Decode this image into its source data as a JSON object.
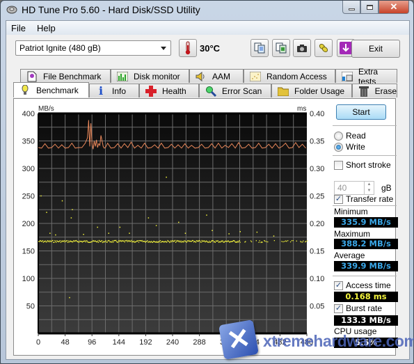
{
  "window": {
    "title": "HD Tune Pro 5.60 - Hard Disk/SSD Utility",
    "controls": {
      "minimize": "minimize",
      "maximize": "maximize",
      "close": "close"
    }
  },
  "menu": {
    "file": "File",
    "help": "Help"
  },
  "toolbar": {
    "drive": "Patriot Ignite (480 gB)",
    "temperature": "30°C",
    "icons": [
      "copy-text-icon",
      "copy-screenshot-icon",
      "camera-icon",
      "coins-icon",
      "download-icon"
    ],
    "exit_label": "Exit"
  },
  "tabs": {
    "row_back": [
      {
        "label": "File Benchmark",
        "icon": "file-benchmark-icon"
      },
      {
        "label": "Disk monitor",
        "icon": "disk-monitor-icon"
      },
      {
        "label": "AAM",
        "icon": "speaker-icon"
      },
      {
        "label": "Random Access",
        "icon": "random-access-icon"
      },
      {
        "label": "Extra tests",
        "icon": "extra-tests-icon"
      }
    ],
    "row_front": [
      {
        "label": "Benchmark",
        "icon": "lightbulb-icon",
        "active": true
      },
      {
        "label": "Info",
        "icon": "info-icon"
      },
      {
        "label": "Health",
        "icon": "health-cross-icon"
      },
      {
        "label": "Error Scan",
        "icon": "magnifier-icon"
      },
      {
        "label": "Folder Usage",
        "icon": "folder-icon"
      },
      {
        "label": "Erase",
        "icon": "trash-icon"
      }
    ]
  },
  "side": {
    "start_label": "Start",
    "read_label": "Read",
    "write_label": "Write",
    "mode": "Write",
    "short_stroke_label": "Short stroke",
    "short_stroke_checked": false,
    "short_stroke_value": "40",
    "short_stroke_unit": "gB",
    "transfer_rate_label": "Transfer rate",
    "transfer_rate_checked": true,
    "minimum_label": "Minimum",
    "minimum_value": "335.9 MB/s",
    "maximum_label": "Maximum",
    "maximum_value": "388.2 MB/s",
    "average_label": "Average",
    "average_value": "339.9 MB/s",
    "access_time_label": "Access time",
    "access_time_checked": true,
    "access_time_value": "0.168 ms",
    "burst_rate_label": "Burst rate",
    "burst_rate_checked": true,
    "burst_rate_value": "133.3 MB/s",
    "cpu_usage_label": "CPU usage",
    "cpu_usage_value": "5.5%",
    "value_color_blue": "#3aa7e8",
    "value_color_yellow": "#f2f23c",
    "value_color_white": "#ffffff"
  },
  "watermark": {
    "text": "xtremehardware.com"
  },
  "chart_data": {
    "type": "line",
    "title": "",
    "ylabel_left": "MB/s",
    "ylabel_right": "ms",
    "xlabel": "gB",
    "xlim": [
      0,
      480
    ],
    "ylim_left": [
      0,
      400
    ],
    "ylim_right": [
      0,
      0.4
    ],
    "x_ticks": [
      "0",
      "48",
      "96",
      "144",
      "192",
      "240",
      "288",
      "336",
      "384",
      "432",
      "480"
    ],
    "y_ticks_left": [
      "50",
      "100",
      "150",
      "200",
      "250",
      "300",
      "350",
      "400"
    ],
    "y_ticks_right": [
      "0.05",
      "0.10",
      "0.15",
      "0.20",
      "0.25",
      "0.30",
      "0.35",
      "0.40"
    ],
    "grid": true,
    "series": [
      {
        "name": "Transfer rate",
        "axis": "left",
        "color": "#e8875a",
        "x": [
          0,
          6,
          12,
          18,
          24,
          30,
          36,
          42,
          48,
          54,
          60,
          66,
          72,
          78,
          84,
          88,
          90,
          92,
          94,
          96,
          98,
          100,
          102,
          104,
          106,
          108,
          110,
          112,
          114,
          116,
          118,
          120,
          124,
          130,
          136,
          142,
          148,
          154,
          160,
          166,
          172,
          178,
          184,
          190,
          196,
          202,
          208,
          214,
          220,
          226,
          232,
          238,
          244,
          250,
          256,
          262,
          268,
          274,
          280,
          286,
          292,
          298,
          304,
          310,
          316,
          322,
          328,
          334,
          340,
          346,
          352,
          358,
          364,
          370,
          376,
          382,
          388,
          394,
          400,
          406,
          412,
          418,
          424,
          430,
          436,
          442,
          448,
          454,
          460,
          466,
          472,
          478
        ],
        "y": [
          338,
          337,
          345,
          337,
          338,
          344,
          337,
          343,
          337,
          338,
          346,
          337,
          338,
          338,
          346,
          356,
          388,
          340,
          382,
          345,
          335,
          350,
          340,
          352,
          338,
          345,
          342,
          360,
          350,
          340,
          337,
          338,
          346,
          337,
          338,
          345,
          337,
          345,
          338,
          348,
          337,
          342,
          337,
          346,
          337,
          338,
          343,
          337,
          346,
          337,
          338,
          344,
          337,
          343,
          337,
          345,
          337,
          342,
          337,
          338,
          344,
          337,
          338,
          345,
          337,
          346,
          337,
          342,
          338,
          345,
          337,
          347,
          337,
          338,
          344,
          337,
          338,
          346,
          337,
          338,
          344,
          337,
          345,
          337,
          340,
          346,
          337,
          338,
          347,
          338,
          344,
          337,
          345,
          337
        ]
      },
      {
        "name": "Access time",
        "axis": "right",
        "type": "scatter",
        "color": "#f2f23c",
        "note": "dense band around 0.168 ms with sparse outliers",
        "band_value": 0.168,
        "outliers": [
          {
            "x": 4,
            "y": 0.251
          },
          {
            "x": 14,
            "y": 0.221
          },
          {
            "x": 42,
            "y": 0.242
          },
          {
            "x": 60,
            "y": 0.226
          },
          {
            "x": 58,
            "y": 0.211
          },
          {
            "x": 55,
            "y": 0.066
          },
          {
            "x": 105,
            "y": 0.194
          },
          {
            "x": 145,
            "y": 0.194
          },
          {
            "x": 162,
            "y": 0.183
          },
          {
            "x": 196,
            "y": 0.211
          },
          {
            "x": 210,
            "y": 0.197
          },
          {
            "x": 250,
            "y": 0.203
          },
          {
            "x": 262,
            "y": 0.183
          },
          {
            "x": 300,
            "y": 0.216
          },
          {
            "x": 310,
            "y": 0.188
          },
          {
            "x": 340,
            "y": 0.182
          },
          {
            "x": 360,
            "y": 0.186
          },
          {
            "x": 390,
            "y": 0.185
          },
          {
            "x": 420,
            "y": 0.178
          },
          {
            "x": 228,
            "y": 0.285
          },
          {
            "x": 20,
            "y": 0.183
          },
          {
            "x": 30,
            "y": 0.18
          },
          {
            "x": 80,
            "y": 0.181
          },
          {
            "x": 125,
            "y": 0.183
          }
        ]
      }
    ]
  }
}
